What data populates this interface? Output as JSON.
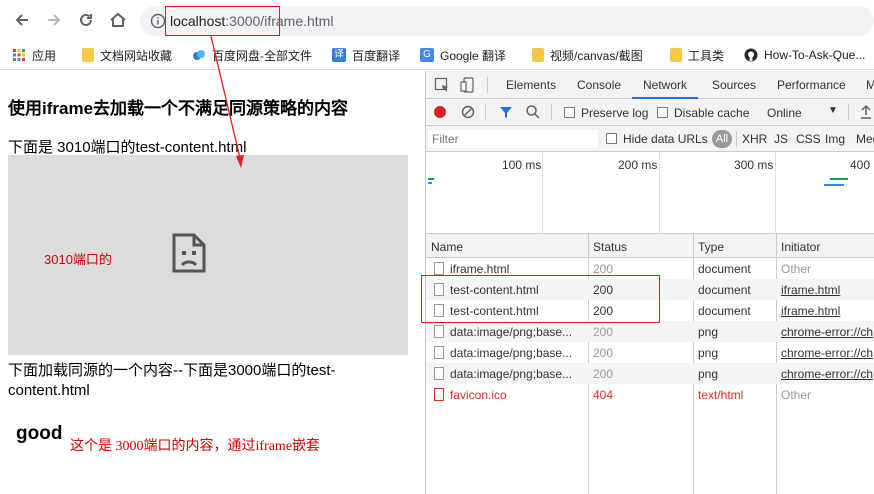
{
  "browser": {
    "url_host": "localhost",
    "url_port": ":3000/",
    "url_path": "iframe.html",
    "bookmarks": [
      {
        "label": "应用",
        "icon": "apps-grid-icon"
      },
      {
        "label": "文档网站收藏",
        "icon": "folder-icon"
      },
      {
        "label": "百度网盘-全部文件",
        "icon": "baidu-pan-icon"
      },
      {
        "label": "百度翻译",
        "icon": "baidu-translate-icon"
      },
      {
        "label": "Google 翻译",
        "icon": "google-translate-icon"
      },
      {
        "label": "视频/canvas/截图",
        "icon": "folder-icon"
      },
      {
        "label": "工具类",
        "icon": "folder-icon"
      },
      {
        "label": "How-To-Ask-Que...",
        "icon": "github-icon"
      }
    ]
  },
  "page": {
    "title": "使用iframe去加载一个不满足同源策略的内容",
    "line1": "下面是 3010端口的test-content.html",
    "iframe_note": "3010端口的",
    "line2": "下面加载同源的一个内容--下面是3000端口的test-content.html",
    "good": "good",
    "good_note": "这个是 3000端口的内容，通过iframe嵌套"
  },
  "devtools": {
    "tabs": [
      "Elements",
      "Console",
      "Network",
      "Sources",
      "Performance",
      "M"
    ],
    "active_tab": "Network",
    "preserve_log": "Preserve log",
    "disable_cache": "Disable cache",
    "throttle": "Online",
    "filter_placeholder": "Filter",
    "hide_data_urls": "Hide data URLs",
    "all": "All",
    "type_filters": [
      "XHR",
      "JS",
      "CSS",
      "Img",
      "Med"
    ],
    "timeline_ticks": [
      "100 ms",
      "200 ms",
      "300 ms",
      "400"
    ],
    "columns": [
      "Name",
      "Status",
      "Type",
      "Initiator"
    ],
    "rows": [
      {
        "name": "iframe.html",
        "status": "200",
        "type": "document",
        "initiator": "Other"
      },
      {
        "name": "test-content.html",
        "status": "200",
        "type": "document",
        "initiator": "iframe.html"
      },
      {
        "name": "test-content.html",
        "status": "200",
        "type": "document",
        "initiator": "iframe.html"
      },
      {
        "name": "data:image/png;base...",
        "status": "200",
        "type": "png",
        "initiator": "chrome-error://ch"
      },
      {
        "name": "data:image/png;base...",
        "status": "200",
        "type": "png",
        "initiator": "chrome-error://ch"
      },
      {
        "name": "data:image/png;base...",
        "status": "200",
        "type": "png",
        "initiator": "chrome-error://ch"
      },
      {
        "name": "favicon.ico",
        "status": "404",
        "type": "text/html",
        "initiator": "Other"
      }
    ]
  },
  "colors": {
    "annotation_red": "#e0201e",
    "error_red": "#d93025",
    "link_blue": "#1a73e8"
  }
}
